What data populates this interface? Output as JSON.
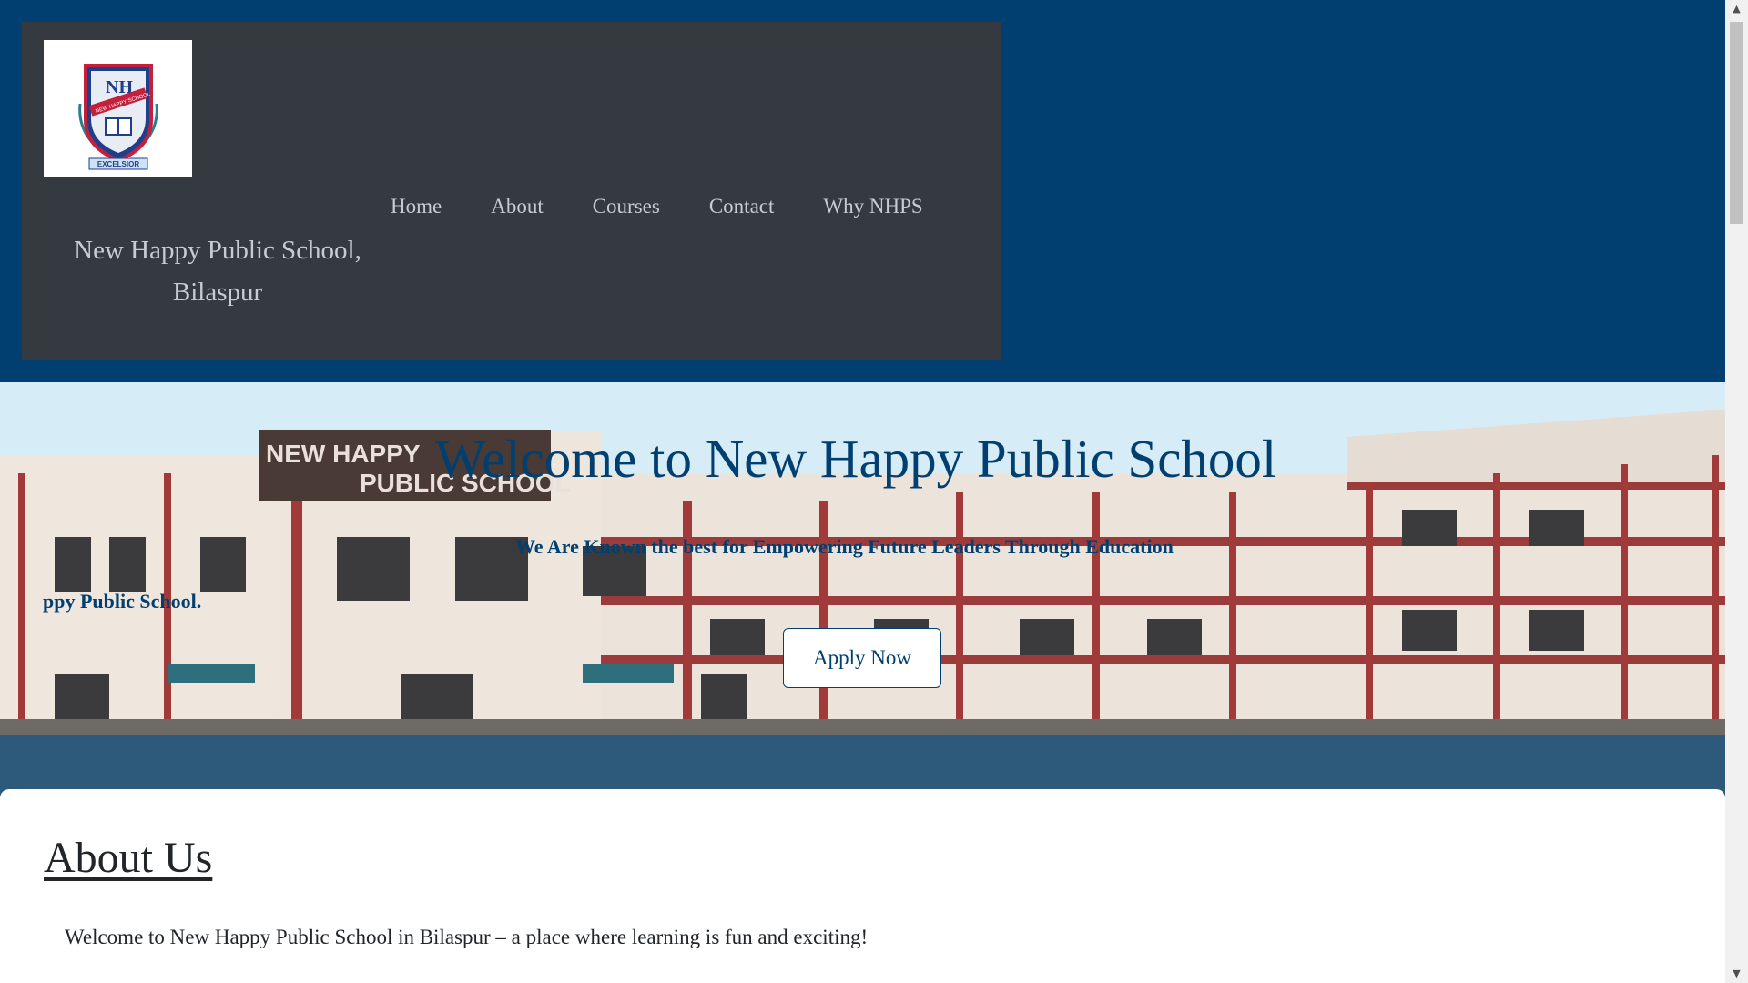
{
  "header": {
    "school_name_line1": "New Happy Public School,",
    "school_name_line2": "Bilaspur",
    "logo_badge_name": "NEW HAPPY SCHOOL",
    "logo_motto": "EXCELSIOR",
    "nav": [
      "Home",
      "About",
      "Courses",
      "Contact",
      "Why NHPS"
    ]
  },
  "hero": {
    "title": "Welcome to New Happy Public School",
    "tagline": "We Are Known the best for Empowering Future Leaders Through Education",
    "marquee_text": "ppy Public School.",
    "building_sign_line1": "NEW HAPPY",
    "building_sign_line2": "PUBLIC SCHOOL",
    "apply_button": "Apply Now"
  },
  "about": {
    "heading": "About Us",
    "intro": "Welcome to New Happy Public School in Bilaspur – a place where learning is fun and exciting!"
  },
  "colors": {
    "header_band": "#003f70",
    "header_box": "#343a40",
    "page_background": "#2d5a7b",
    "accent_text": "#003f70",
    "about_background": "#ffffff"
  },
  "icons": {
    "logo": "school-crest-icon",
    "scroll_up": "scroll-up-arrow-icon",
    "scroll_down": "scroll-down-arrow-icon"
  }
}
